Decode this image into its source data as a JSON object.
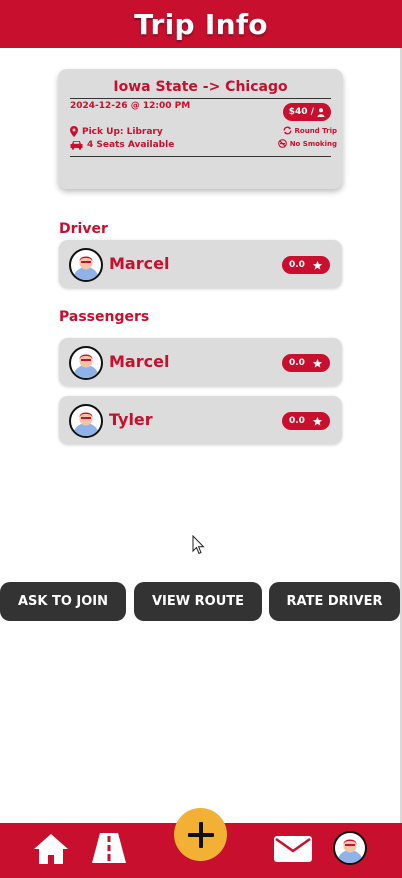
{
  "header": {
    "title": "Trip Info"
  },
  "trip": {
    "route": "Iowa State -> Chicago",
    "datetime": "2024-12-26 @ 12:00 PM",
    "price": "$40 /",
    "pickup": "Pick Up: Library",
    "seats": "4 Seats Available",
    "round_trip": "Round Trip",
    "smoking": "No Smoking"
  },
  "driver": {
    "label": "Driver",
    "name": "Marcel",
    "rating": "0.0"
  },
  "passengers": {
    "label": "Passengers",
    "items": [
      {
        "name": "Marcel",
        "rating": "0.0"
      },
      {
        "name": "Tyler",
        "rating": "0.0"
      }
    ]
  },
  "actions": {
    "join": "ASK TO JOIN",
    "route": "VIEW ROUTE",
    "rate": "RATE DRIVER"
  },
  "nav": {
    "icons": [
      "home-icon",
      "road-icon",
      "plus-icon",
      "mail-icon",
      "avatar"
    ]
  },
  "colors": {
    "brand": "#c8102e",
    "card": "#dcdcdc",
    "button": "#333333",
    "accent": "#f2b134"
  }
}
